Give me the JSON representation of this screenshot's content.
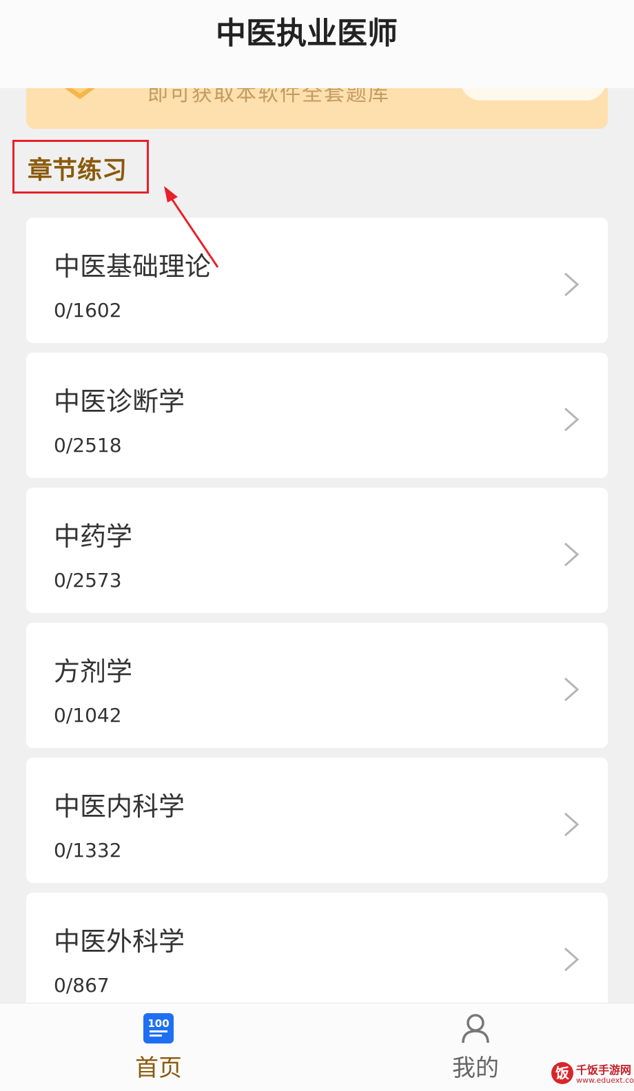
{
  "header": {
    "title": "中医执业医师"
  },
  "banner": {
    "text": "即可获取本软件全套题库"
  },
  "section": {
    "title": "章节练习"
  },
  "chapters": [
    {
      "name": "中医基础理论",
      "progress": "0/1602"
    },
    {
      "name": "中医诊断学",
      "progress": "0/2518"
    },
    {
      "name": "中药学",
      "progress": "0/2573"
    },
    {
      "name": "方剂学",
      "progress": "0/1042"
    },
    {
      "name": "中医内科学",
      "progress": "0/1332"
    },
    {
      "name": "中医外科学",
      "progress": "0/867"
    }
  ],
  "tabbar": {
    "home": {
      "label": "首页",
      "icon": "question-bank-icon",
      "active": true
    },
    "mine": {
      "label": "我的",
      "icon": "person-icon",
      "active": false
    }
  },
  "watermark": {
    "badge": "饭",
    "name": "千饭手游网",
    "url": "www.eduext.com"
  },
  "colors": {
    "accent": "#8a5a0b",
    "banner_bg": "#fde0ae",
    "annotation_red": "#e8202a",
    "tab_icon_blue": "#1f6ff2"
  }
}
